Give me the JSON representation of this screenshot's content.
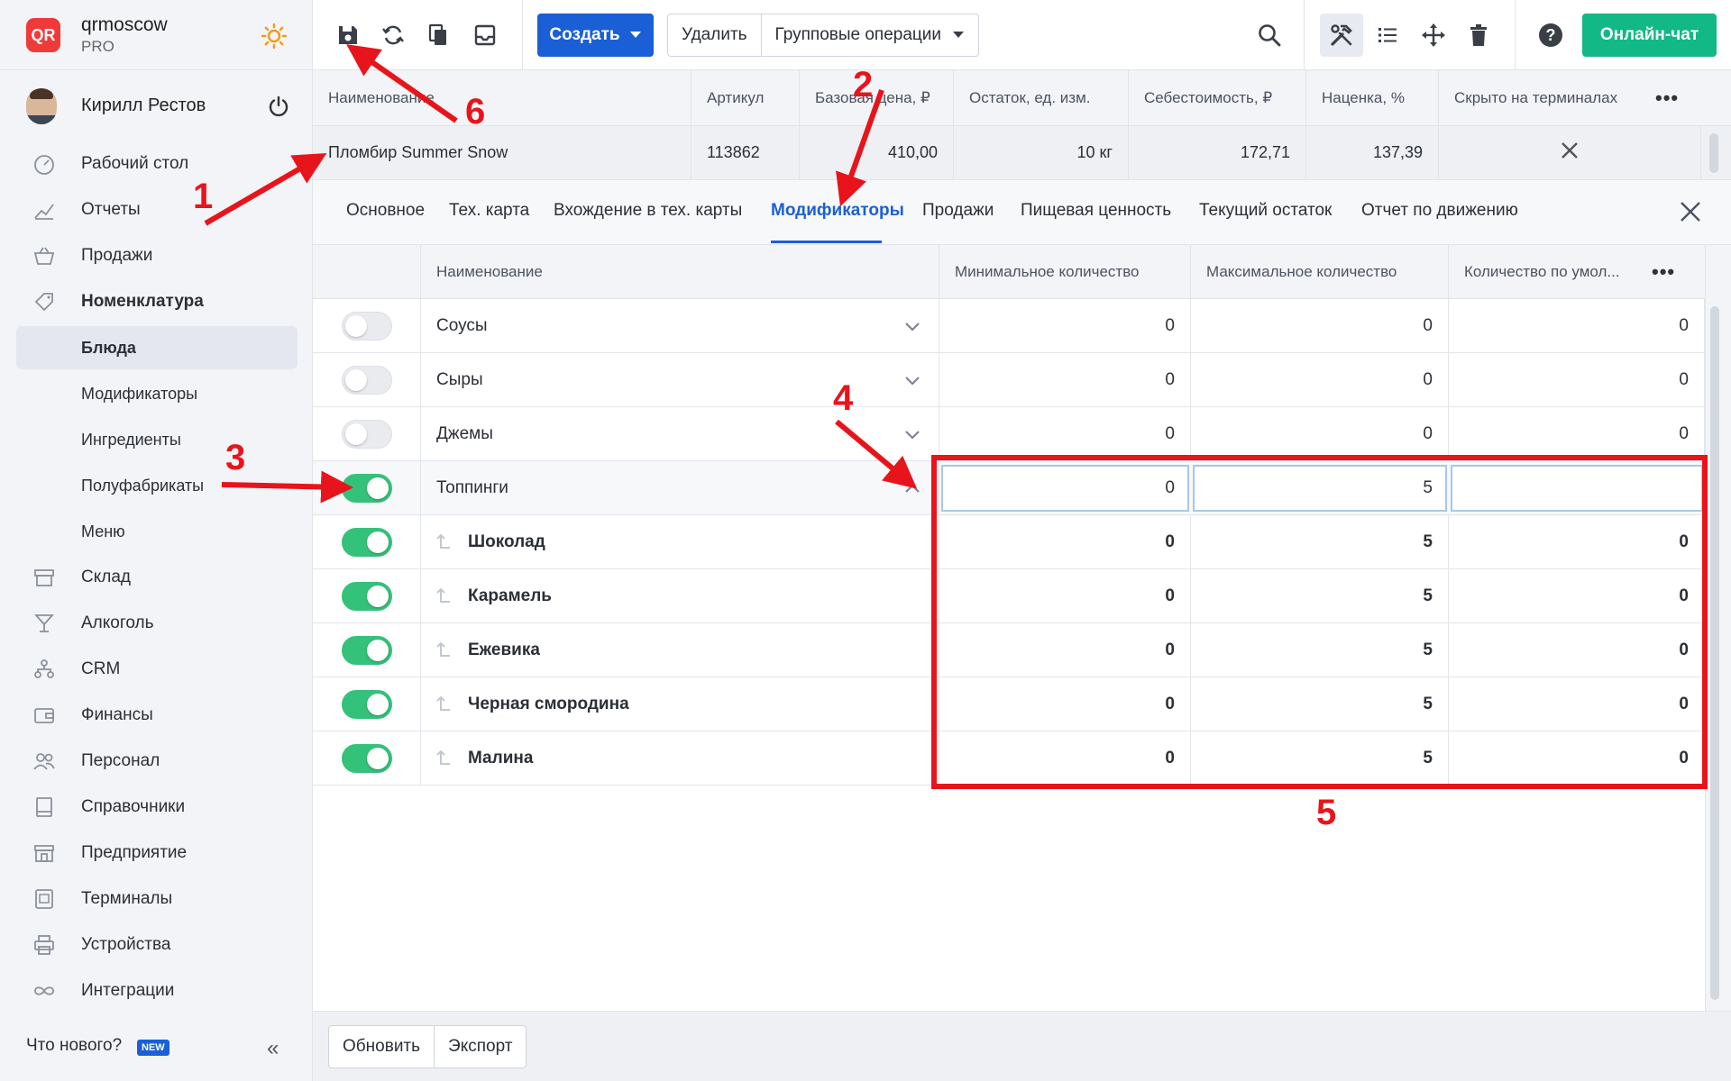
{
  "brand": {
    "logo": "QR",
    "name": "qrmoscow",
    "plan": "PRO"
  },
  "user": {
    "name": "Кирилл Рестов"
  },
  "nav": {
    "items": [
      {
        "label": "Рабочий стол",
        "icon": "dashboard-icon"
      },
      {
        "label": "Отчеты",
        "icon": "chart-icon"
      },
      {
        "label": "Продажи",
        "icon": "basket-icon"
      },
      {
        "label": "Номенклатура",
        "icon": "tag-icon"
      },
      {
        "label": "Блюда"
      },
      {
        "label": "Модификаторы"
      },
      {
        "label": "Ингредиенты"
      },
      {
        "label": "Полуфабрикаты"
      },
      {
        "label": "Меню"
      },
      {
        "label": "Склад",
        "icon": "warehouse-icon"
      },
      {
        "label": "Алкоголь",
        "icon": "glass-icon"
      },
      {
        "label": "CRM",
        "icon": "crm-icon"
      },
      {
        "label": "Финансы",
        "icon": "wallet-icon"
      },
      {
        "label": "Персонал",
        "icon": "people-icon"
      },
      {
        "label": "Справочники",
        "icon": "book-icon"
      },
      {
        "label": "Предприятие",
        "icon": "store-icon"
      },
      {
        "label": "Терминалы",
        "icon": "terminal-icon"
      },
      {
        "label": "Устройства",
        "icon": "printer-icon"
      },
      {
        "label": "Интеграции",
        "icon": "infinity-icon"
      }
    ],
    "whats_new": "Что нового?",
    "new_badge": "NEW"
  },
  "toolbar": {
    "create": "Создать",
    "delete": "Удалить",
    "group_ops": "Групповые операции",
    "chat": "Онлайн-чат"
  },
  "product_table": {
    "headers": [
      "Наименование",
      "Артикул",
      "Базовая цена, ₽",
      "Остаток, ед. изм.",
      "Себестоимость, ₽",
      "Наценка, %",
      "Скрыто на терминалах"
    ],
    "row": {
      "name": "Пломбир Summer Snow",
      "sku": "113862",
      "price": "410,00",
      "stock": "10 кг",
      "cost": "172,71",
      "markup": "137,39"
    }
  },
  "tabs": [
    "Основное",
    "Тех. карта",
    "Вхождение в тех. карты",
    "Модификаторы",
    "Продажи",
    "Пищевая ценность",
    "Текущий остаток",
    "Отчет по движению"
  ],
  "modifiers": {
    "headers": [
      "Наименование",
      "Минимальное количество",
      "Максимальное количество",
      "Количество по умол..."
    ],
    "groups": [
      {
        "name": "Соусы",
        "min": "0",
        "max": "0",
        "def": "0",
        "on": false
      },
      {
        "name": "Сыры",
        "min": "0",
        "max": "0",
        "def": "0",
        "on": false
      },
      {
        "name": "Джемы",
        "min": "0",
        "max": "0",
        "def": "0",
        "on": false
      },
      {
        "name": "Топпинги",
        "min": "0",
        "max": "5",
        "def": "",
        "on": true
      }
    ],
    "children": [
      {
        "name": "Шоколад",
        "min": "0",
        "max": "5",
        "def": "0"
      },
      {
        "name": "Карамель",
        "min": "0",
        "max": "5",
        "def": "0"
      },
      {
        "name": "Ежевика",
        "min": "0",
        "max": "5",
        "def": "0"
      },
      {
        "name": "Черная смородина",
        "min": "0",
        "max": "5",
        "def": "0"
      },
      {
        "name": "Малина",
        "min": "0",
        "max": "5",
        "def": "0"
      }
    ]
  },
  "footer": {
    "refresh": "Обновить",
    "export": "Экспорт"
  },
  "annotations": [
    "1",
    "2",
    "3",
    "4",
    "5",
    "6"
  ],
  "colors": {
    "accent": "#1a5fd6",
    "chat": "#12b886",
    "toggle_on": "#34c17a",
    "annotation": "#e8141b"
  }
}
